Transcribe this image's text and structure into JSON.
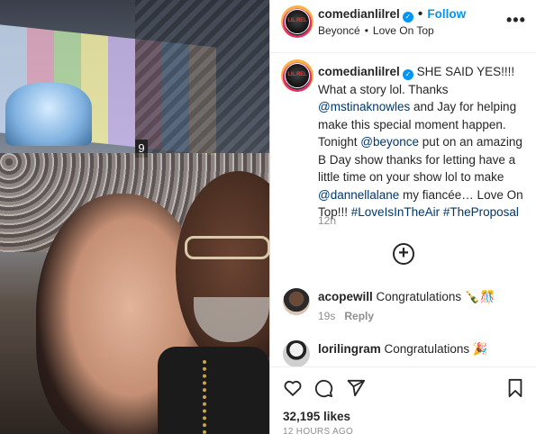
{
  "post": {
    "author": "comedianlilrel",
    "follow_label": "Follow",
    "music_artist": "Beyoncé",
    "music_song": "Love On Top",
    "avatar_text": "LIL REL",
    "caption": {
      "username": "comedianlilrel",
      "parts": [
        {
          "t": "SHE SAID YES!!!! What a story lol. Thanks ",
          "link": false
        },
        {
          "t": "@mstinaknowles",
          "link": true
        },
        {
          "t": " and Jay for helping make this special moment happen. Tonight ",
          "link": false
        },
        {
          "t": "@beyonce",
          "link": true
        },
        {
          "t": " put on an amazing B Day show thanks for letting have a little time on your show lol to make ",
          "link": false
        },
        {
          "t": "@dannellalane",
          "link": true
        },
        {
          "t": " my fiancée… Love On Top!!! ",
          "link": false
        },
        {
          "t": "#LoveIsInTheAir",
          "link": true
        },
        {
          "t": " ",
          "link": false
        },
        {
          "t": "#TheProposal",
          "link": true
        }
      ],
      "time": "12h"
    },
    "load_more_symbol": "+",
    "comments": [
      {
        "username": "acopewill",
        "text": "Congratulations 🍾🎊",
        "time": "19s",
        "reply_label": "Reply"
      },
      {
        "username": "lorilingram",
        "text": "Congratulations 🎉",
        "time": "",
        "reply_label": ""
      }
    ],
    "likes": "32,195 likes",
    "timestamp": "12 HOURS AGO",
    "icons": {
      "verified": "verified-badge-icon",
      "more": "more-options-icon",
      "like": "heart-icon",
      "comment": "comment-bubble-icon",
      "share": "share-plane-icon",
      "save": "bookmark-icon",
      "load_more": "plus-circle-icon"
    },
    "colors": {
      "accent": "#0095f6",
      "link": "#00376b",
      "muted": "#8e8e8e",
      "text": "#262626"
    }
  }
}
